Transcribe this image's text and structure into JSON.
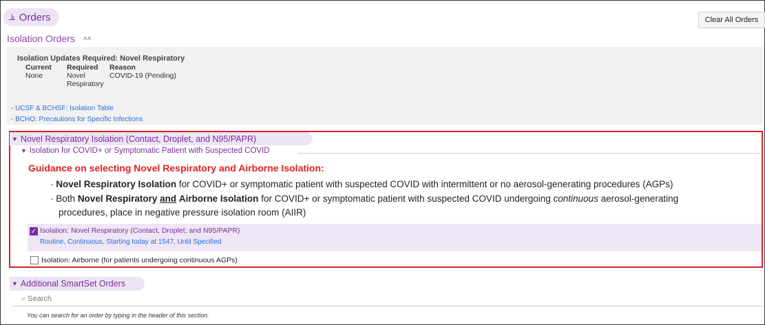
{
  "header": {
    "icon": "pin-icon",
    "title": "Orders",
    "clear_button": "Clear All Orders"
  },
  "isolation_orders": {
    "title": "Isolation Orders",
    "updates_heading": "Isolation Updates Required: Novel Respiratory",
    "columns": {
      "current": {
        "header": "Current",
        "value": "None"
      },
      "required": {
        "header": "Required",
        "value_line1": "Novel",
        "value_line2": "Respiratory"
      },
      "reason": {
        "header": "Reason",
        "value": "COVID-19 (Pending)"
      }
    },
    "links": [
      {
        "dash": "- ",
        "text": "UCSF & BCHSF: Isolation Table"
      },
      {
        "dash": "- ",
        "text": "BCHO: Precautions for Specific Infections"
      }
    ]
  },
  "novel_section": {
    "title": "Novel Respiratory Isolation (Contact, Droplet, and N95/PAPR)",
    "subsection": "Isolation for COVID+ or Symptomatic Patient with Suspected COVID",
    "guidance_title": "Guidance on selecting Novel Respiratory and Airborne Isolation:",
    "bullet1": {
      "dot": "·",
      "bold": "Novel Respiratory Isolation",
      "rest": "for COVID+ or symptomatic patient with suspected COVID with intermittent or no aerosol-generating procedures (AGPs)"
    },
    "bullet2": {
      "dot": "·",
      "pre": "Both",
      "bold1": "Novel Respiratory",
      "and": "and",
      "bold2": "Airborne Isolation",
      "mid": "for COVID+ or symptomatic patient with suspected COVID undergoing",
      "italic": "continuous",
      "post": "aerosol-generating",
      "line2": "procedures, place in negative pressure isolation room (AIIR)"
    },
    "order1": {
      "checked": true,
      "label": "Isolation: Novel Respiratory (Contact, Droplet, and N95/PAPR)",
      "details": "Routine, Continuous, Starting today at 1547, Until Specified"
    },
    "order2": {
      "checked": false,
      "label": "Isolation: Airborne (for patients undergoing continuous AGPs)"
    }
  },
  "additional": {
    "title": "Additional SmartSet Orders",
    "search_placeholder": "Search",
    "hint": "You can search for an order by typing in the header of this section."
  },
  "colors": {
    "accent": "#7b2d9b",
    "link": "#2a6fd6",
    "alert": "#e02020",
    "highlight": "#eee6f5"
  }
}
